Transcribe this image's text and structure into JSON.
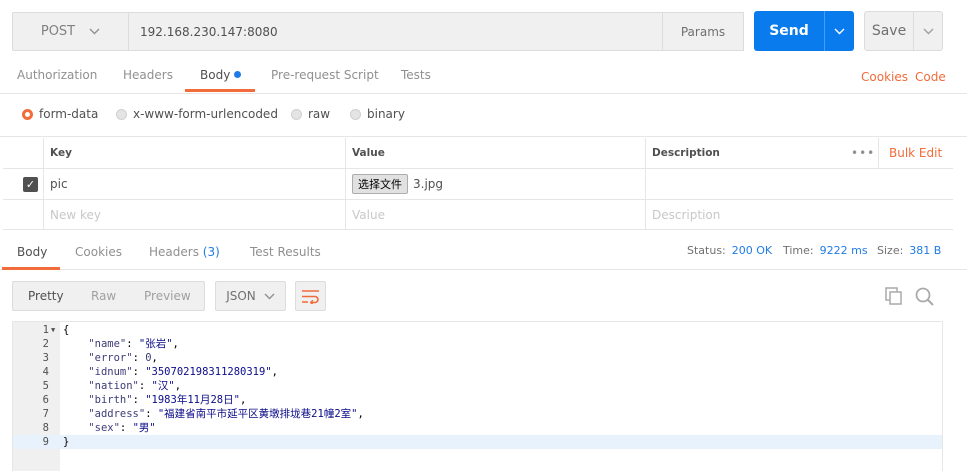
{
  "request": {
    "method": "POST",
    "url": "192.168.230.147:8080",
    "params_label": "Params",
    "send_label": "Send",
    "save_label": "Save"
  },
  "request_tabs": {
    "authorization": "Authorization",
    "headers": "Headers",
    "body": "Body",
    "prerequest": "Pre-request Script",
    "tests": "Tests",
    "cookies": "Cookies",
    "code": "Code"
  },
  "body_types": {
    "form_data": "form-data",
    "urlencoded": "x-www-form-urlencoded",
    "raw": "raw",
    "binary": "binary",
    "selected": "form-data"
  },
  "kv_table": {
    "headers": {
      "key": "Key",
      "value": "Value",
      "description": "Description",
      "bulk_edit": "Bulk Edit"
    },
    "rows": [
      {
        "checked": true,
        "key": "pic",
        "file_button": "选择文件",
        "value": "3.jpg",
        "description": ""
      }
    ],
    "placeholders": {
      "key": "New key",
      "value": "Value",
      "description": "Description"
    }
  },
  "response_tabs": {
    "body": "Body",
    "cookies": "Cookies",
    "headers": "Headers",
    "headers_count": "(3)",
    "test_results": "Test Results"
  },
  "status": {
    "status_label": "Status:",
    "status_value": "200 OK",
    "time_label": "Time:",
    "time_value": "9222 ms",
    "size_label": "Size:",
    "size_value": "381 B"
  },
  "view_modes": {
    "pretty": "Pretty",
    "raw": "Raw",
    "preview": "Preview",
    "format": "JSON"
  },
  "response_body": {
    "lines": [
      {
        "n": "1",
        "open": "{"
      },
      {
        "n": "2",
        "key": "\"name\"",
        "val": "\"张岩\"",
        "tail": ","
      },
      {
        "n": "3",
        "key": "\"error\"",
        "val": "0",
        "tail": ","
      },
      {
        "n": "4",
        "key": "\"idnum\"",
        "val": "\"350702198311280319\"",
        "tail": ","
      },
      {
        "n": "5",
        "key": "\"nation\"",
        "val": "\"汉\"",
        "tail": ","
      },
      {
        "n": "6",
        "key": "\"birth\"",
        "val": "\"1983年11月28日\"",
        "tail": ","
      },
      {
        "n": "7",
        "key": "\"address\"",
        "val": "\"福建省南平市延平区黄墩排垅巷21幢2室\"",
        "tail": ","
      },
      {
        "n": "8",
        "key": "\"sex\"",
        "val": "\"男\"",
        "tail": ""
      },
      {
        "n": "9",
        "open": "}"
      }
    ]
  },
  "colors": {
    "accent": "#f26b3a",
    "primary": "#097bed",
    "link": "#1f7ce6"
  }
}
